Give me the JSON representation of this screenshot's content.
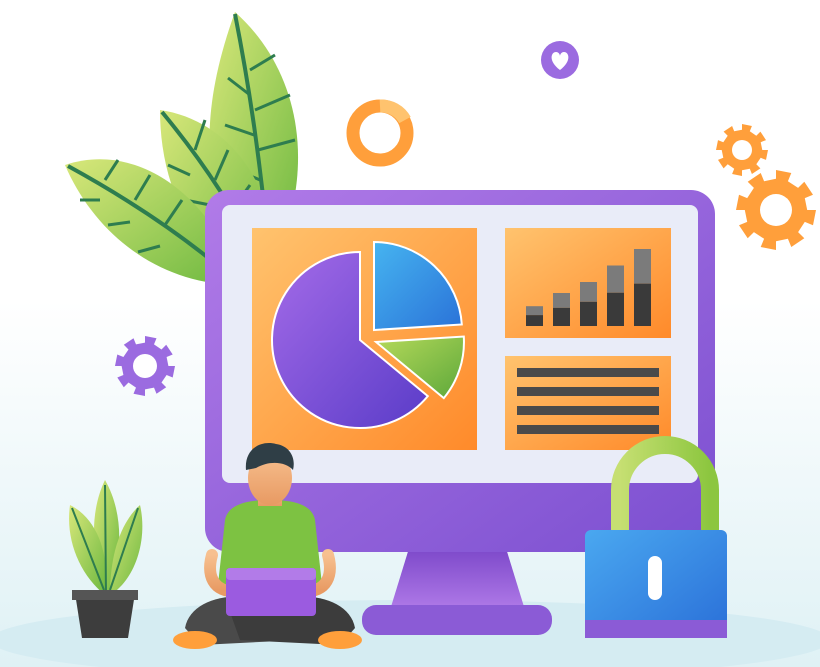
{
  "illustration": {
    "subject": "",
    "colors": {
      "background_top": "#ffffff",
      "background_bottom": "#dff1f5",
      "monitor_frame": "#8b5bd6",
      "monitor_frame_light": "#b17be8",
      "screen": "#e9ecf8",
      "panel_orange": "#ff9f3b",
      "panel_orange_light": "#ffc36e",
      "pie_purple": "#8a4fe0",
      "pie_blue": "#2f8fe6",
      "pie_green": "#8cc63f",
      "bar_dark": "#3a3a3a",
      "bar_light": "#7b7b7b",
      "leaf_green": "#7cc242",
      "leaf_light": "#c9e06a",
      "leaf_vein": "#2e7d4f",
      "lock_blue": "#2e8fe3",
      "lock_purple": "#8b5bd6",
      "shackle": "#b8d86a",
      "gear_orange": "#ff9f3b",
      "gear_purple": "#9b6be0",
      "person_shirt": "#7dc242",
      "person_skin": "#f4b07d",
      "person_hair": "#2f3e46",
      "person_pants": "#4a4a4a",
      "pot": "#3d3d3d"
    },
    "icons": [
      "monitor-icon",
      "pie-chart-icon",
      "bar-chart-icon",
      "padlock-icon",
      "gear-icon",
      "heart-icon",
      "ring-icon",
      "leaf-icon",
      "plant-icon",
      "person-icon",
      "laptop-icon"
    ],
    "chart_panel": {
      "bar_levels": [
        0.18,
        0.3,
        0.4,
        0.55,
        0.7
      ]
    },
    "pie_panel": {
      "slice_fractions": [
        0.64,
        0.24,
        0.12
      ]
    },
    "text_panel": {
      "line_count": 4
    }
  }
}
